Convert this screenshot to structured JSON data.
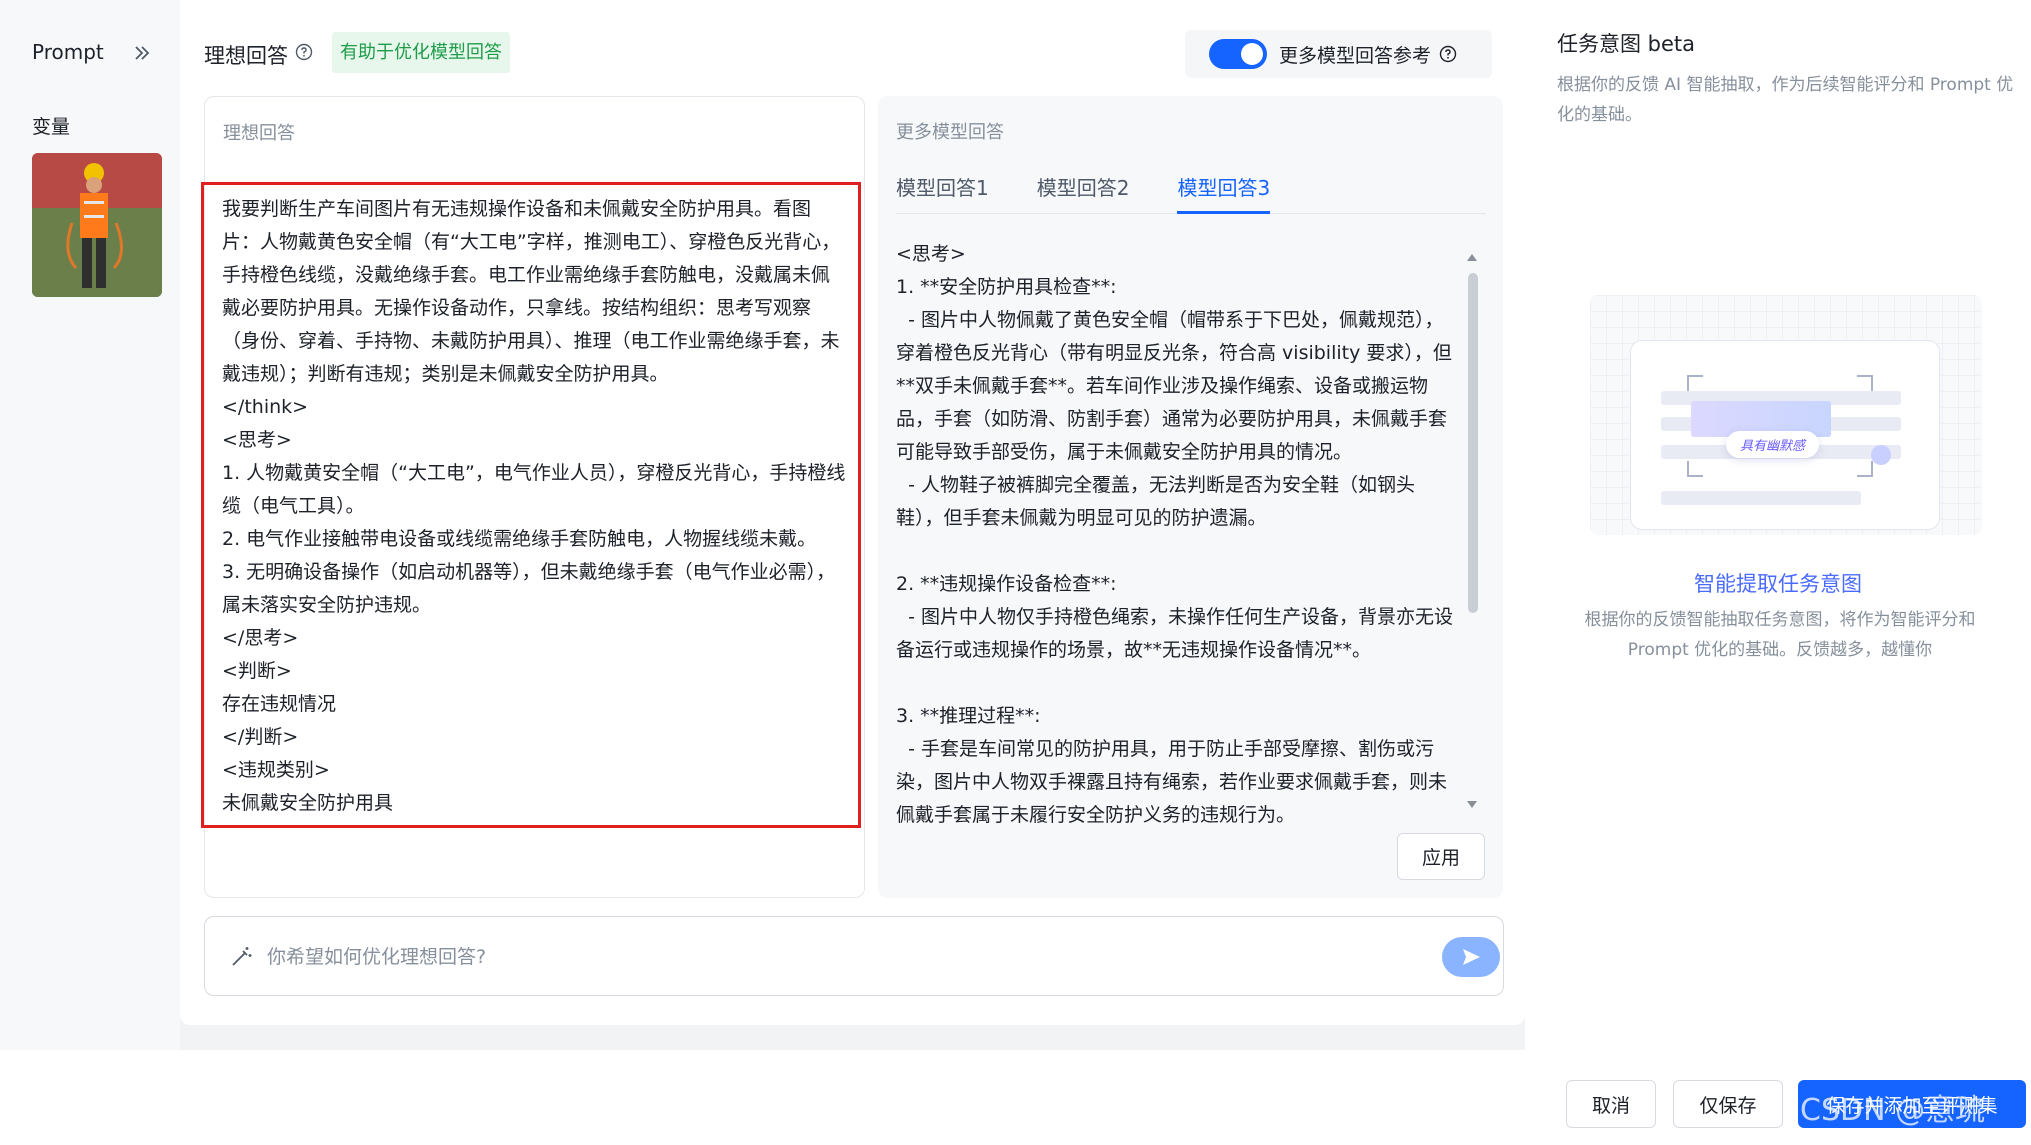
{
  "sidebar": {
    "prompt_label": "Prompt",
    "variables_label": "变量"
  },
  "ideal": {
    "title": "理想回答",
    "helpful_tag": "有助于优化模型回答",
    "card_label": "理想回答",
    "text": "我要判断生产车间图片有无违规操作设备和未佩戴安全防护用具。看图片：人物戴黄色安全帽（有“大工电”字样，推测电工）、穿橙色反光背心，手持橙色线缆，没戴绝缘手套。电工作业需绝缘手套防触电，没戴属未佩戴必要防护用具。无操作设备动作，只拿线。按结构组织：思考写观察（身份、穿着、手持物、未戴防护用具）、推理（电工作业需绝缘手套，未戴违规）；判断有违规；类别是未佩戴安全防护用具。\n</think>\n<思考>\n1. 人物戴黄安全帽（“大工电”，电气作业人员），穿橙反光背心，手持橙线缆（电气工具）。\n2. 电气作业接触带电设备或线缆需绝缘手套防触电，人物握线缆未戴。\n3. 无明确设备操作（如启动机器等），但未戴绝缘手套（电气作业必需），属未落实安全防护违规。\n</思考>\n<判断>\n存在违规情况\n</判断>\n<违规类别>\n未佩戴安全防护用具"
  },
  "more": {
    "toggle_label": "更多模型回答参考",
    "toggle_on": true,
    "card_label": "更多模型回答",
    "tabs": [
      "模型回答1",
      "模型回答2",
      "模型回答3"
    ],
    "active_tab": 2,
    "text": "<思考>\n1. **安全防护用具检查**:\n  - 图片中人物佩戴了黄色安全帽（帽带系于下巴处，佩戴规范），穿着橙色反光背心（带有明显反光条，符合高 visibility 要求），但**双手未佩戴手套**。若车间作业涉及操作绳索、设备或搬运物品，手套（如防滑、防割手套）通常为必要防护用具，未佩戴手套可能导致手部受伤，属于未佩戴安全防护用具的情况。\n  - 人物鞋子被裤脚完全覆盖，无法判断是否为安全鞋（如钢头鞋），但手套未佩戴为明显可见的防护遗漏。\n\n2. **违规操作设备检查**:\n  - 图片中人物仅手持橙色绳索，未操作任何生产设备，背景亦无设备运行或违规操作的场景，故**无违规操作设备情况**。\n\n3. **推理过程**:\n  - 手套是车间常见的防护用具，用于防止手部受摩擦、割伤或污染，图片中人物双手裸露且持有绳索，若作业要求佩戴手套，则未佩戴手套属于未履行安全防护义务的违规行为。",
    "apply_label": "应用"
  },
  "optimize": {
    "placeholder": "你希望如何优化理想回答?"
  },
  "intent": {
    "title": "任务意图 beta",
    "desc": "根据你的反馈 AI 智能抽取，作为后续智能评分和 Prompt 优化的基础。",
    "illus_chip": "具有幽默感",
    "link": "智能提取任务意图",
    "link_desc": "根据你的反馈智能抽取任务意图，将作为智能评分和 Prompt 优化的基础。反馈越多，越懂你"
  },
  "footer": {
    "cancel": "取消",
    "save_only": "仅保存",
    "save_add": "保存并添加至评测集",
    "watermark": "CSDN @意琉"
  },
  "colors": {
    "primary": "#1664ff",
    "highlight_border": "#e02020",
    "tag_green": "#1e9c4a"
  }
}
